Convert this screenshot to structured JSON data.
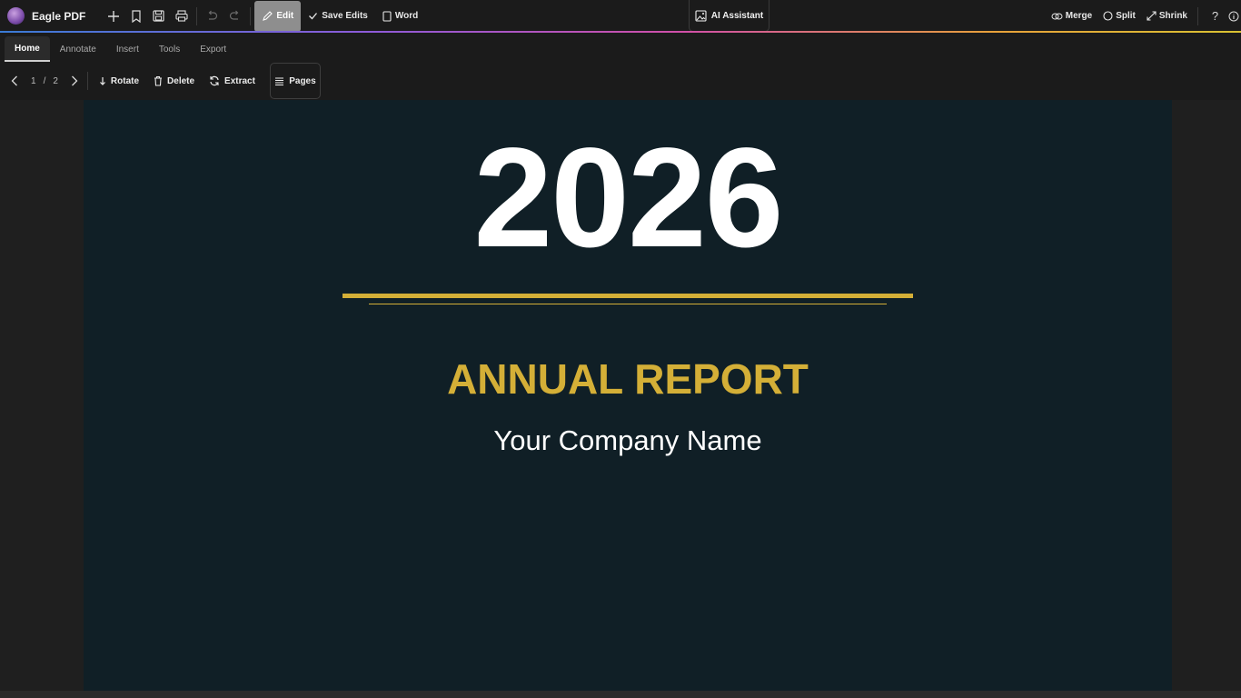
{
  "app": {
    "name": "Eagle PDF"
  },
  "topbar": {
    "edit_label": "Edit",
    "save_edits_label": "Save Edits",
    "word_label": "Word",
    "ai_label": "AI Assistant",
    "merge_label": "Merge",
    "split_label": "Split",
    "shrink_label": "Shrink"
  },
  "tabs": [
    {
      "label": "Home",
      "active": true
    },
    {
      "label": "Annotate"
    },
    {
      "label": "Insert"
    },
    {
      "label": "Tools"
    },
    {
      "label": "Export"
    }
  ],
  "toolbar": {
    "current_page": "1",
    "separator": "/",
    "total_pages": "2",
    "rotate_label": "Rotate",
    "delete_label": "Delete",
    "extract_label": "Extract",
    "pages_label": "Pages"
  },
  "document": {
    "year": "2026",
    "title": "ANNUAL REPORT",
    "company": "Your Company Name"
  },
  "colors": {
    "accent_gold": "#d4af37",
    "page_bg": "#101f26",
    "chrome_bg": "#1b1b1b"
  },
  "icons": [
    "app-logo-icon",
    "plus-icon",
    "bookmark-icon",
    "save-icon",
    "print-icon",
    "undo-icon",
    "redo-icon",
    "pencil-icon",
    "check-icon",
    "word-doc-icon",
    "ai-image-icon",
    "merge-icon",
    "split-icon",
    "shrink-icon",
    "help-icon",
    "info-icon",
    "chevron-left-icon",
    "chevron-right-icon",
    "arrow-down-icon",
    "trash-icon",
    "refresh-icon",
    "list-icon"
  ]
}
